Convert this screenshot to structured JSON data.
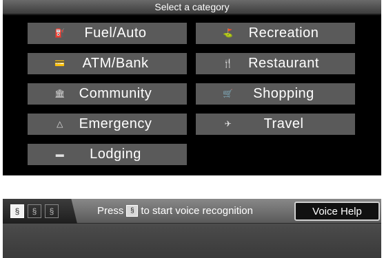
{
  "category_screen": {
    "header": "Select a category",
    "categories": [
      {
        "label": "Fuel/Auto",
        "icon": "fuel-pump-icon",
        "glyph": "⛽"
      },
      {
        "label": "Recreation",
        "icon": "recreation-icon",
        "glyph": "⛳"
      },
      {
        "label": "ATM/Bank",
        "icon": "bank-icon",
        "glyph": "💳"
      },
      {
        "label": "Restaurant",
        "icon": "restaurant-icon",
        "glyph": "🍴"
      },
      {
        "label": "Community",
        "icon": "community-icon",
        "glyph": "🏛"
      },
      {
        "label": "Shopping",
        "icon": "shopping-cart-icon",
        "glyph": "🛒"
      },
      {
        "label": "Emergency",
        "icon": "emergency-icon",
        "glyph": "△"
      },
      {
        "label": "Travel",
        "icon": "airplane-icon",
        "glyph": "✈"
      },
      {
        "label": "Lodging",
        "icon": "bed-icon",
        "glyph": "▬"
      }
    ]
  },
  "voice_bar": {
    "tab_icons": [
      "voice-icon",
      "voice-tab-2-icon",
      "voice-tab-3-icon"
    ],
    "prompt_before": "Press",
    "prompt_after": "to start voice recognition",
    "voice_help_label": "Voice Help"
  }
}
